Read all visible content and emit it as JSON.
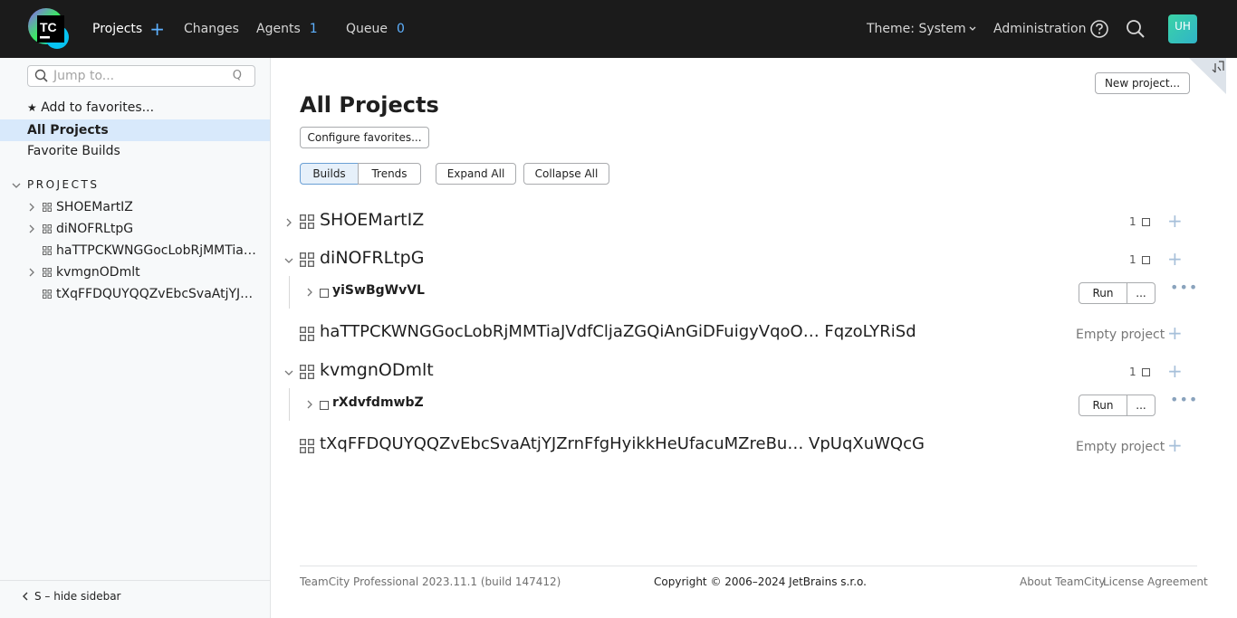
{
  "header": {
    "logo_text": "TC",
    "projects": "Projects",
    "changes": "Changes",
    "agents": "Agents",
    "agents_count": "1",
    "queue": "Queue",
    "queue_count": "0",
    "theme": "Theme: System",
    "administration": "Administration",
    "avatar": "UH"
  },
  "sidebar": {
    "search_placeholder": "Jump to...",
    "add_favorites": "Add to favorites...",
    "all_projects": "All Projects",
    "favorite_builds": "Favorite Builds",
    "section": "PROJECTS",
    "tree": [
      {
        "label": "SHOEMartIZ"
      },
      {
        "label": "diNOFRLtpG"
      },
      {
        "label": "haTTPCKWNGGocLobRjMMTiaJVdfCljaZGQiAnGiDFuigyVqoOFqzoLYRiSd"
      },
      {
        "label": "kvmgnODmlt"
      },
      {
        "label": "tXqFFDQUYQQZvEbcSvaAtjYJZrnFfgHyikkHeUfacuMZreBuVpUqXuWQcG"
      }
    ],
    "hide": "S – hide sidebar"
  },
  "main": {
    "new_project": "New project...",
    "title": "All Projects",
    "configure_favorites": "Configure favorites...",
    "tab_builds": "Builds",
    "tab_trends": "Trends",
    "expand_all": "Expand All",
    "collapse_all": "Collapse All",
    "run": "Run",
    "more_btn": "...",
    "empty_project": "Empty project",
    "projects": [
      {
        "name": "SHOEMartIZ",
        "count": "1"
      },
      {
        "name": "diNOFRLtpG",
        "count": "1",
        "build": "yiSwBgWvVL"
      },
      {
        "name": "haTTPCKWNGGocLobRjMMTiaJVdfCljaZGQiAnGiDFuigyVqoO… FqzoLYRiSd"
      },
      {
        "name": "kvmgnODmlt",
        "count": "1",
        "build": "rXdvfdmwbZ"
      },
      {
        "name": "tXqFFDQUYQQZvEbcSvaAtjYJZrnFfgHyikkHeUfacuMZreBu…  VpUqXuWQcG"
      }
    ]
  },
  "footer": {
    "version": "TeamCity Professional 2023.11.1 (build 147412)",
    "copyright": "Copyright © 2006–2024 JetBrains s.r.o.",
    "about": "About TeamCity",
    "license": "License Agreement"
  }
}
